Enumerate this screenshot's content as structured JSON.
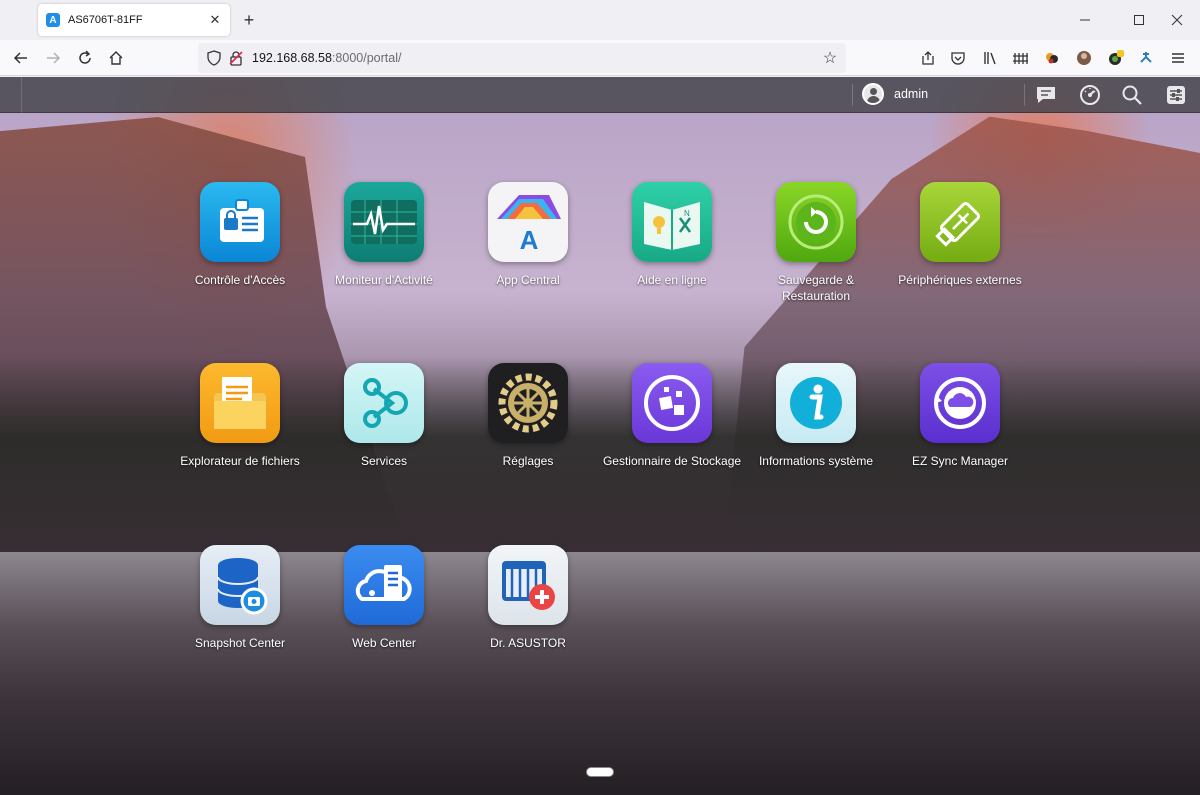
{
  "browser": {
    "tab_title": "AS6706T-81FF",
    "tab_close": "✕",
    "new_tab": "+",
    "url_host": "192.168.68.58",
    "url_rest": ":8000/portal/"
  },
  "portal": {
    "user_name": "admin",
    "apps": [
      {
        "label": "Contrôle d'Accès",
        "icon": "id-card-icon"
      },
      {
        "label": "Moniteur d'Activité",
        "icon": "heartbeat-monitor-icon"
      },
      {
        "label": "App Central",
        "icon": "app-central-icon"
      },
      {
        "label": "Aide en ligne",
        "icon": "help-book-icon"
      },
      {
        "label": "Sauvegarde & Restauration",
        "icon": "backup-restore-icon"
      },
      {
        "label": "Périphériques externes",
        "icon": "usb-device-icon"
      },
      {
        "label": "Explorateur de fichiers",
        "icon": "folder-icon"
      },
      {
        "label": "Services",
        "icon": "services-network-icon"
      },
      {
        "label": "Réglages",
        "icon": "settings-gear-icon"
      },
      {
        "label": "Gestionnaire de Stockage",
        "icon": "storage-manager-icon"
      },
      {
        "label": "Informations système",
        "icon": "info-icon"
      },
      {
        "label": "EZ Sync Manager",
        "icon": "ez-sync-cloud-icon"
      },
      {
        "label": "Snapshot Center",
        "icon": "snapshot-database-icon"
      },
      {
        "label": "Web Center",
        "icon": "web-center-icon"
      },
      {
        "label": "Dr. ASUSTOR",
        "icon": "dr-asustor-icon"
      }
    ]
  }
}
